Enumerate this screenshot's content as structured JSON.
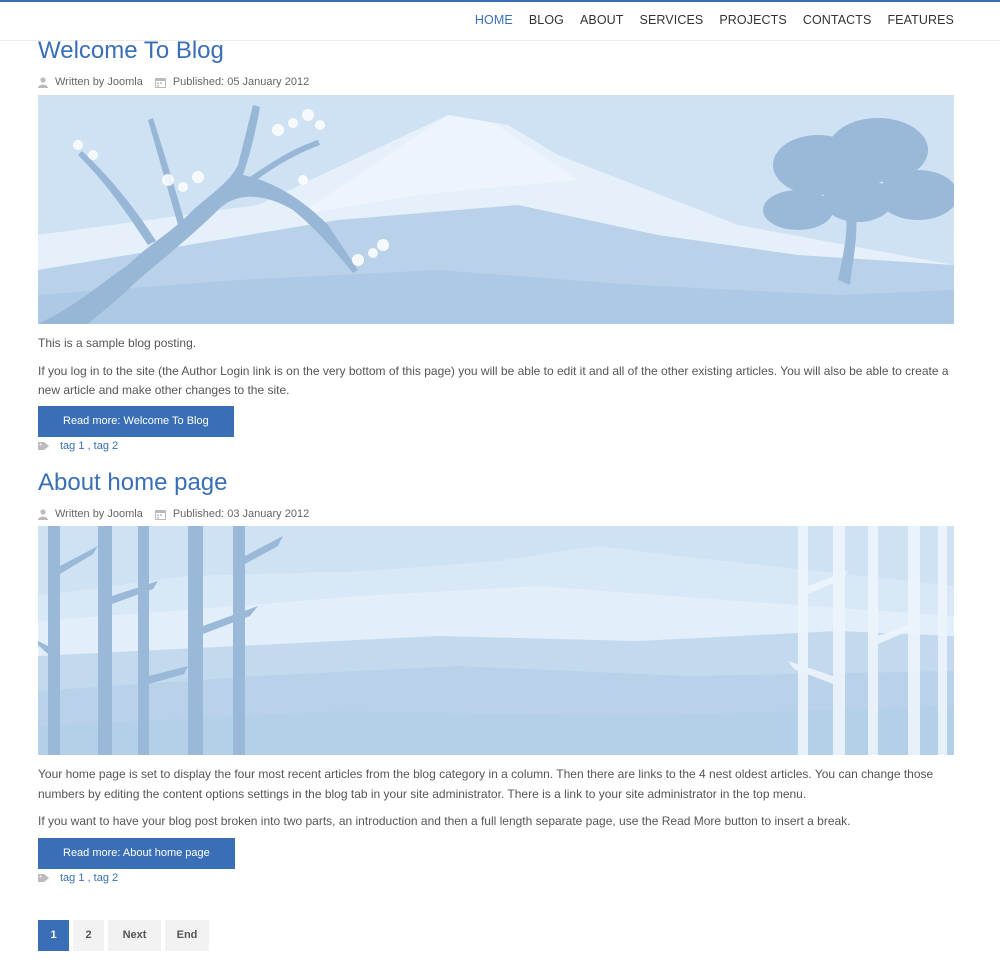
{
  "nav": {
    "items": [
      "HOME",
      "BLOG",
      "ABOUT",
      "SERVICES",
      "PROJECTS",
      "CONTACTS",
      "FEATURES"
    ],
    "active": "HOME"
  },
  "articles": [
    {
      "title": "Welcome To Blog",
      "author": "Written by Joomla",
      "published": "Published: 05 January 2012",
      "image": "mountain-cherry-blossom-banner",
      "paragraphs": [
        "This is a sample blog posting.",
        "If you log in to the site (the Author Login link is on the very bottom of this page) you will be able to edit it and all of the other existing articles. You will also be able to create a new article and make other changes to the site."
      ],
      "read_more": "Read more: Welcome To Blog",
      "tags": [
        "tag 1",
        "tag 2"
      ]
    },
    {
      "title": "About home page",
      "author": "Written by Joomla",
      "published": "Published: 03 January 2012",
      "image": "bamboo-mountain-banner",
      "paragraphs": [
        "Your home page is set to display the four most recent articles from the blog category in a column. Then there are links to the 4 nest oldest articles. You can change those numbers by editing the content options settings in the blog tab in your site administrator. There is a link to your site administrator in the top menu.",
        "If you want to have your blog post broken into two parts, an introduction and then a full length separate page, use the Read More button to insert a break."
      ],
      "read_more": "Read more: About home page",
      "tags": [
        "tag 1",
        "tag 2"
      ]
    }
  ],
  "pagination": {
    "current": "1",
    "pages": [
      "2"
    ],
    "next": "Next",
    "end": "End"
  },
  "colors": {
    "accent": "#3a6fb7",
    "banner_sky": "#cfe2f3",
    "banner_shape": "#a9c6e2"
  }
}
